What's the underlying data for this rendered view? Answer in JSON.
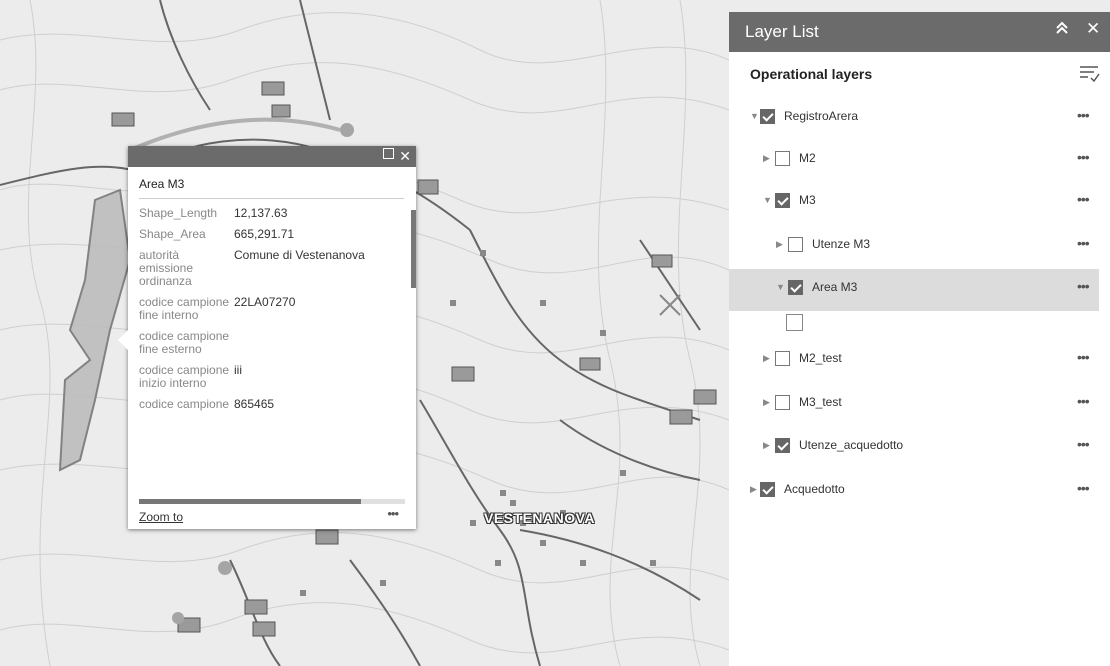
{
  "map": {
    "place_label": "VESTENANOVA"
  },
  "popup": {
    "title": "Area M3",
    "fields": [
      {
        "key": "Shape_Length",
        "value": "12,137.63"
      },
      {
        "key": "Shape_Area",
        "value": "665,291.71"
      },
      {
        "key": "autorità emissione ordinanza",
        "value": "Comune di Vestenanova"
      },
      {
        "key": "codice campione fine interno",
        "value": "22LA07270"
      },
      {
        "key": "codice campione fine esterno",
        "value": ""
      },
      {
        "key": "codice campione inizio interno",
        "value": "iii"
      },
      {
        "key": "codice campione",
        "value": "865465"
      }
    ],
    "zoom_to": "Zoom to",
    "more": "•••",
    "close": "✕"
  },
  "panel": {
    "title": "Layer List",
    "collapse": "⌃⌃",
    "close": "✕",
    "section_title": "Operational layers",
    "layers": [
      {
        "label": "RegistroArera",
        "checked": true,
        "expanded": true
      },
      {
        "label": "M2",
        "checked": false,
        "expanded": false
      },
      {
        "label": "M3",
        "checked": true,
        "expanded": true
      },
      {
        "label": "Utenze M3",
        "checked": false,
        "expanded": false
      },
      {
        "label": "Area M3",
        "checked": true,
        "expanded": true
      },
      {
        "label": "M2_test",
        "checked": false,
        "expanded": false
      },
      {
        "label": "M3_test",
        "checked": false,
        "expanded": false
      },
      {
        "label": "Utenze_acquedotto",
        "checked": true,
        "expanded": false
      },
      {
        "label": "Acquedotto",
        "checked": true,
        "expanded": false
      }
    ],
    "more": "•••"
  }
}
